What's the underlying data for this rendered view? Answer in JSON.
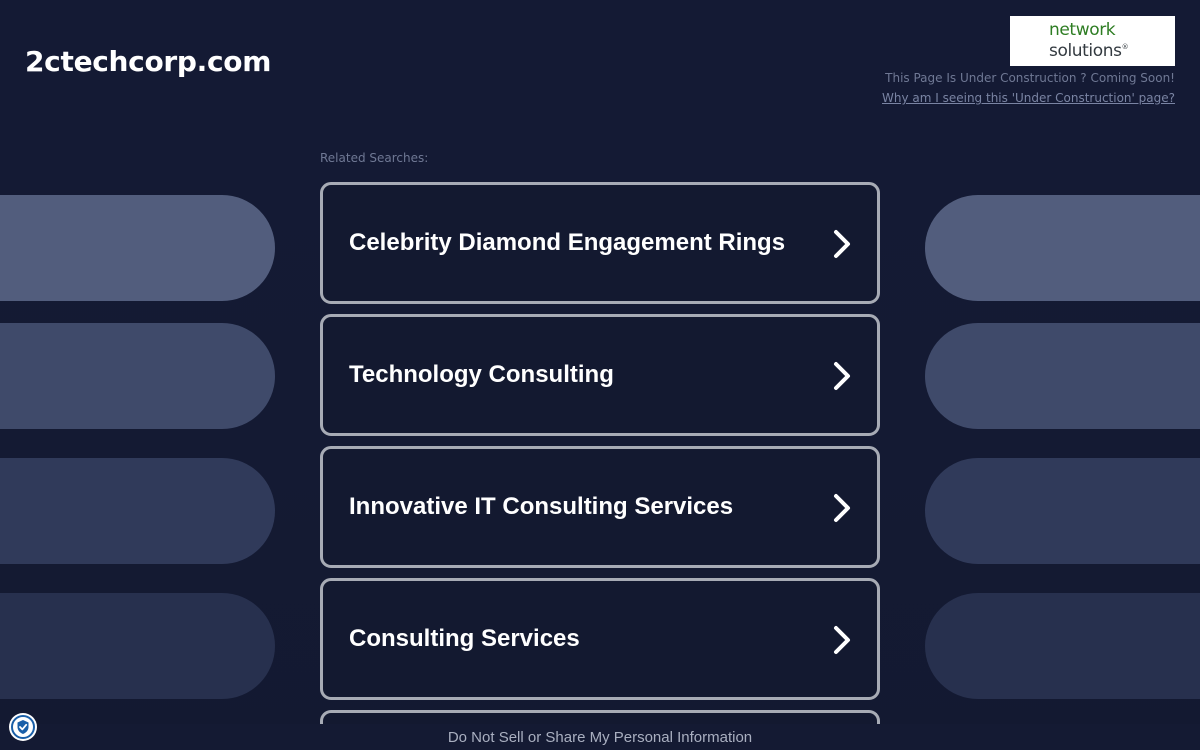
{
  "header": {
    "domain": "2ctechcorp.com",
    "logo": {
      "line1": "network",
      "line2": "solutions",
      "mark": "®",
      "color_primary": "#2e7d23",
      "color_secondary": "#333a40"
    },
    "under_construction_text": "This Page Is Under Construction ? Coming Soon!",
    "why_link": "Why am I seeing this 'Under Construction' page?"
  },
  "main": {
    "related_label": "Related Searches:",
    "links": [
      {
        "label": "Celebrity Diamond Engagement Rings"
      },
      {
        "label": "Technology Consulting"
      },
      {
        "label": "Innovative IT Consulting Services"
      },
      {
        "label": "Consulting Services"
      }
    ],
    "chevron_icon": "chevron-right-icon"
  },
  "footer": {
    "privacy_link": "Do Not Sell or Share My Personal Information",
    "privacy_icon": "privacy-shield-icon"
  },
  "colors": {
    "background": "#141a33",
    "card_border": "#a7abb5",
    "text": "#ffffff"
  }
}
